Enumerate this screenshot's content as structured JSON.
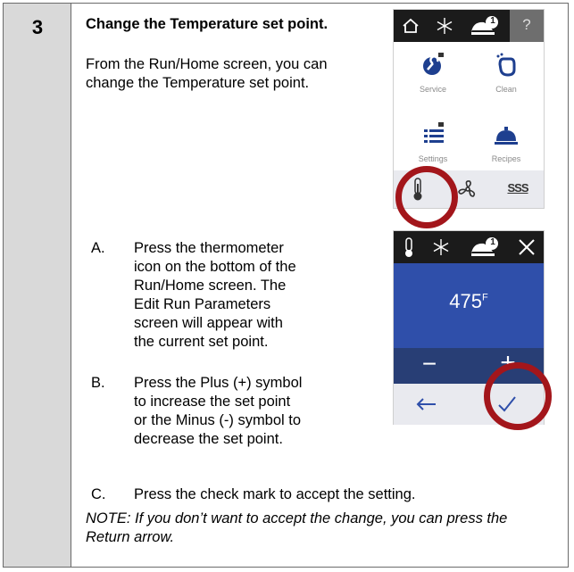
{
  "step": {
    "number": "3"
  },
  "title": "Change the Temperature set point.",
  "intro": "From the Run/Home screen, you can change the Temperature set point.",
  "items": [
    {
      "letter": "A.",
      "text": "Press the thermometer icon on the bottom of the Run/Home screen. The Edit Run Parameters screen will appear with the current set point."
    },
    {
      "letter": "B.",
      "text": "Press the Plus (+) symbol to increase the set point or the Minus (-) symbol to decrease the set point."
    },
    {
      "letter": "C.",
      "text": "Press the check mark to accept the setting."
    }
  ],
  "note": "NOTE: If you don’t want to accept the change, you can press the Return arrow.",
  "home_screen": {
    "top_icons": [
      "home-icon",
      "snowflake-icon",
      "notification-icon",
      "help-icon"
    ],
    "notification_count": "1",
    "help_label": "?",
    "tiles": [
      {
        "icon": "service-wrench-icon",
        "label": "Service",
        "locked": true
      },
      {
        "icon": "clean-hand-icon",
        "label": "Clean",
        "locked": false
      },
      {
        "icon": "settings-list-icon",
        "label": "Settings",
        "locked": true
      },
      {
        "icon": "recipes-cloche-icon",
        "label": "Recipes",
        "locked": false
      }
    ],
    "bottom_icons": [
      "thermometer-icon",
      "fan-icon",
      "heat-icon"
    ],
    "heat_label": "SSS"
  },
  "edit_screen": {
    "top_icons": [
      "thermometer-icon",
      "snowflake-icon",
      "notification-icon",
      "close-icon"
    ],
    "notification_count": "1",
    "temperature": "475",
    "unit": "F",
    "minus_label": "−",
    "plus_label": "+",
    "back_icon": "return-arrow-icon",
    "confirm_icon": "check-icon"
  },
  "colors": {
    "accent_blue": "#2f4faa",
    "dark_blue": "#283e75",
    "highlight_ring": "#a3161b",
    "step_column": "#d9d9d9"
  }
}
